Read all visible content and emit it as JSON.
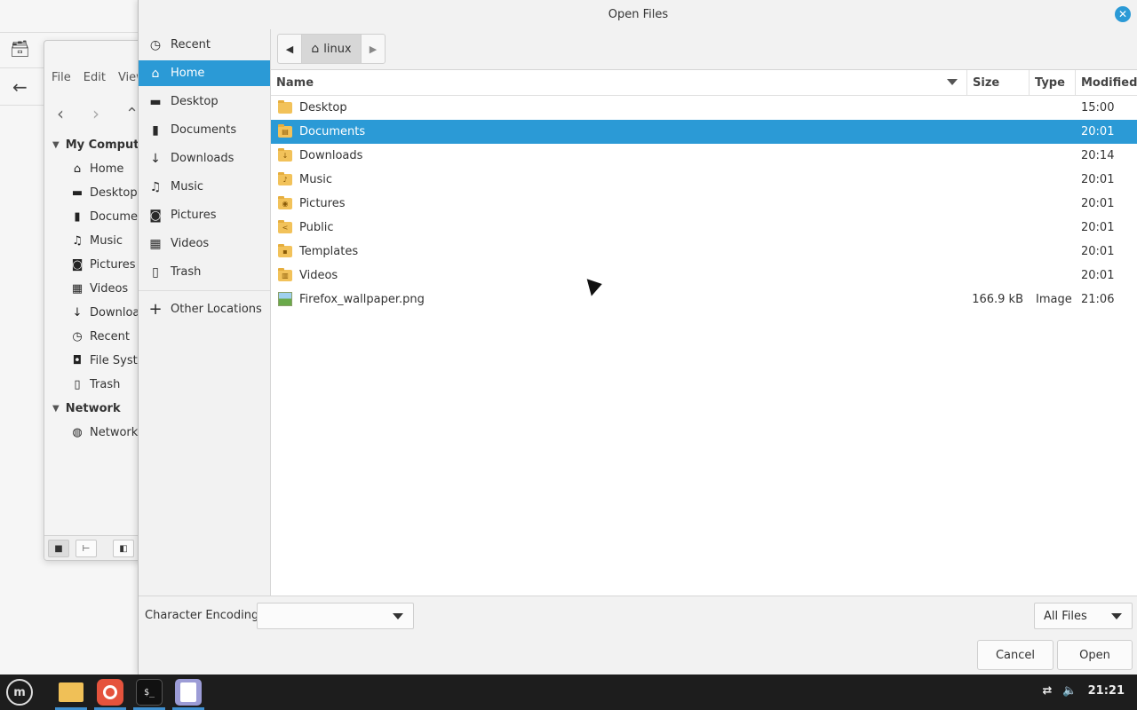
{
  "dialog": {
    "title": "Open Files",
    "close_icon": "close-icon"
  },
  "sidebar": {
    "items": [
      {
        "label": "Recent",
        "icon": "clock-icon"
      },
      {
        "label": "Home",
        "icon": "home-icon"
      },
      {
        "label": "Desktop",
        "icon": "monitor-icon"
      },
      {
        "label": "Documents",
        "icon": "document-icon"
      },
      {
        "label": "Downloads",
        "icon": "download-icon"
      },
      {
        "label": "Music",
        "icon": "music-icon"
      },
      {
        "label": "Pictures",
        "icon": "camera-icon"
      },
      {
        "label": "Videos",
        "icon": "film-icon"
      },
      {
        "label": "Trash",
        "icon": "trash-icon"
      },
      {
        "label": "Other Locations",
        "icon": "plus-icon"
      }
    ],
    "active": "Home"
  },
  "pathbar": {
    "crumb": "linux"
  },
  "filelist": {
    "columns": [
      "Name",
      "Size",
      "Type",
      "Modified"
    ],
    "rows": [
      {
        "name": "Desktop",
        "size": "",
        "type": "",
        "modified": "15:00",
        "kind": "folder",
        "glyph": ""
      },
      {
        "name": "Documents",
        "size": "",
        "type": "",
        "modified": "20:01",
        "kind": "folder",
        "glyph": "▤"
      },
      {
        "name": "Downloads",
        "size": "",
        "type": "",
        "modified": "20:14",
        "kind": "folder",
        "glyph": "↓"
      },
      {
        "name": "Music",
        "size": "",
        "type": "",
        "modified": "20:01",
        "kind": "folder",
        "glyph": "♪"
      },
      {
        "name": "Pictures",
        "size": "",
        "type": "",
        "modified": "20:01",
        "kind": "folder",
        "glyph": "◉"
      },
      {
        "name": "Public",
        "size": "",
        "type": "",
        "modified": "20:01",
        "kind": "folder",
        "glyph": "<"
      },
      {
        "name": "Templates",
        "size": "",
        "type": "",
        "modified": "20:01",
        "kind": "folder",
        "glyph": "▪"
      },
      {
        "name": "Videos",
        "size": "",
        "type": "",
        "modified": "20:01",
        "kind": "folder",
        "glyph": "▥"
      },
      {
        "name": "Firefox_wallpaper.png",
        "size": "166.9 kB",
        "type": "Image",
        "modified": "21:06",
        "kind": "image",
        "glyph": ""
      }
    ],
    "selected": "Documents"
  },
  "bottom": {
    "encoding_label": "Character Encoding:",
    "encoding_value": "",
    "filter_value": "All Files",
    "cancel_label": "Cancel",
    "open_label": "Open"
  },
  "nemo": {
    "menu": [
      "File",
      "Edit",
      "View"
    ],
    "tree": [
      {
        "section": "My Computer",
        "items": [
          {
            "label": "Home",
            "icon": "home-icon"
          },
          {
            "label": "Desktop",
            "icon": "monitor-icon"
          },
          {
            "label": "Documents",
            "icon": "document-icon"
          },
          {
            "label": "Music",
            "icon": "music-icon"
          },
          {
            "label": "Pictures",
            "icon": "camera-icon"
          },
          {
            "label": "Videos",
            "icon": "film-icon"
          },
          {
            "label": "Downloads",
            "icon": "download-icon"
          },
          {
            "label": "Recent",
            "icon": "clock-icon"
          },
          {
            "label": "File System",
            "icon": "drive-icon"
          },
          {
            "label": "Trash",
            "icon": "trash-icon"
          }
        ]
      },
      {
        "section": "Network",
        "items": [
          {
            "label": "Network",
            "icon": "globe-icon"
          }
        ]
      }
    ]
  },
  "taskbar": {
    "apps": [
      "mint-menu",
      "files",
      "firefox",
      "terminal",
      "text-editor"
    ],
    "clock": "21:21"
  },
  "colors": {
    "accent": "#2b9ad6",
    "folder": "#f2c25a",
    "taskbar": "#1d1d1d"
  }
}
